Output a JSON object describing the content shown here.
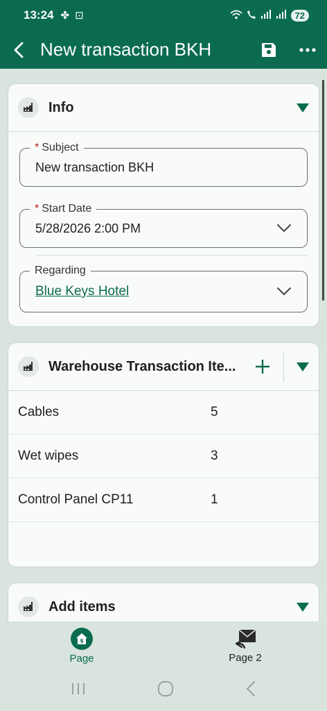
{
  "status_bar": {
    "time": "13:24",
    "battery": "72"
  },
  "app_bar": {
    "title": "New transaction BKH"
  },
  "info": {
    "title": "Info",
    "subject": {
      "label": "Subject",
      "value": "New transaction BKH"
    },
    "start_date": {
      "label": "Start Date",
      "value": "5/28/2026 2:00 PM"
    },
    "regarding": {
      "label": "Regarding",
      "value": "Blue Keys Hotel"
    }
  },
  "items_section": {
    "title": "Warehouse Transaction Ite...",
    "rows": [
      {
        "name": "Cables",
        "qty": "5"
      },
      {
        "name": "Wet wipes",
        "qty": "3"
      },
      {
        "name": "Control Panel CP11",
        "qty": "1"
      }
    ]
  },
  "add_items": {
    "title": "Add items"
  },
  "bottom_nav": {
    "page": "Page",
    "page2": "Page 2"
  },
  "colors": {
    "brand": "#0b6b50",
    "background": "#d9e4de",
    "required": "#b32020"
  }
}
